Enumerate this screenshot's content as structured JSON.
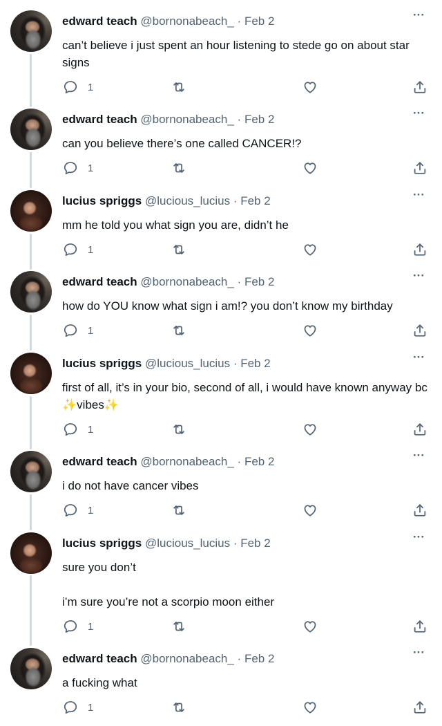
{
  "tweets": [
    {
      "author": "edward teach",
      "handle": "@bornonabeach_",
      "separator": "·",
      "date": "Feb 2",
      "avatar": "teach-avatar",
      "paragraphs": [
        "can’t believe i just spent an hour listening to stede go on about star signs"
      ],
      "reply_count": "1"
    },
    {
      "author": "edward teach",
      "handle": "@bornonabeach_",
      "separator": "·",
      "date": "Feb 2",
      "avatar": "teach-avatar",
      "paragraphs": [
        "can you believe there’s one called CANCER!?"
      ],
      "reply_count": "1"
    },
    {
      "author": "lucius spriggs",
      "handle": "@lucious_lucius",
      "separator": "·",
      "date": "Feb 2",
      "avatar": "spriggs-avatar",
      "paragraphs": [
        "mm he told you what sign you are, didn’t he"
      ],
      "reply_count": "1"
    },
    {
      "author": "edward teach",
      "handle": "@bornonabeach_",
      "separator": "·",
      "date": "Feb 2",
      "avatar": "teach-avatar",
      "paragraphs": [
        "how do YOU know what sign i am!? you don’t know my birthday"
      ],
      "reply_count": "1"
    },
    {
      "author": "lucius spriggs",
      "handle": "@lucious_lucius",
      "separator": "·",
      "date": "Feb 2",
      "avatar": "spriggs-avatar",
      "paragraphs": [],
      "segments": [
        "first of all, it’s in your bio, second of all, i would have known anyway bc ",
        "✨",
        "vibes",
        "✨"
      ],
      "reply_count": "1"
    },
    {
      "author": "edward teach",
      "handle": "@bornonabeach_",
      "separator": "·",
      "date": "Feb 2",
      "avatar": "teach-avatar",
      "paragraphs": [
        "i do not have cancer vibes"
      ],
      "reply_count": "1"
    },
    {
      "author": "lucius spriggs",
      "handle": "@lucious_lucius",
      "separator": "·",
      "date": "Feb 2",
      "avatar": "spriggs-avatar",
      "paragraphs": [
        "sure you don’t",
        "i’m sure you’re not a scorpio moon either"
      ],
      "reply_count": "1"
    },
    {
      "author": "edward teach",
      "handle": "@bornonabeach_",
      "separator": "·",
      "date": "Feb 2",
      "avatar": "teach-avatar",
      "paragraphs": [
        "a fucking what"
      ],
      "reply_count": "1"
    }
  ],
  "more_label": "···",
  "icons": {
    "reply": "reply-icon",
    "retweet": "retweet-icon",
    "like": "heart-icon",
    "share": "share-icon",
    "more": "more-icon"
  },
  "colors": {
    "text": "#0f1419",
    "secondary": "#536471",
    "thread_line": "#cfd9de"
  }
}
